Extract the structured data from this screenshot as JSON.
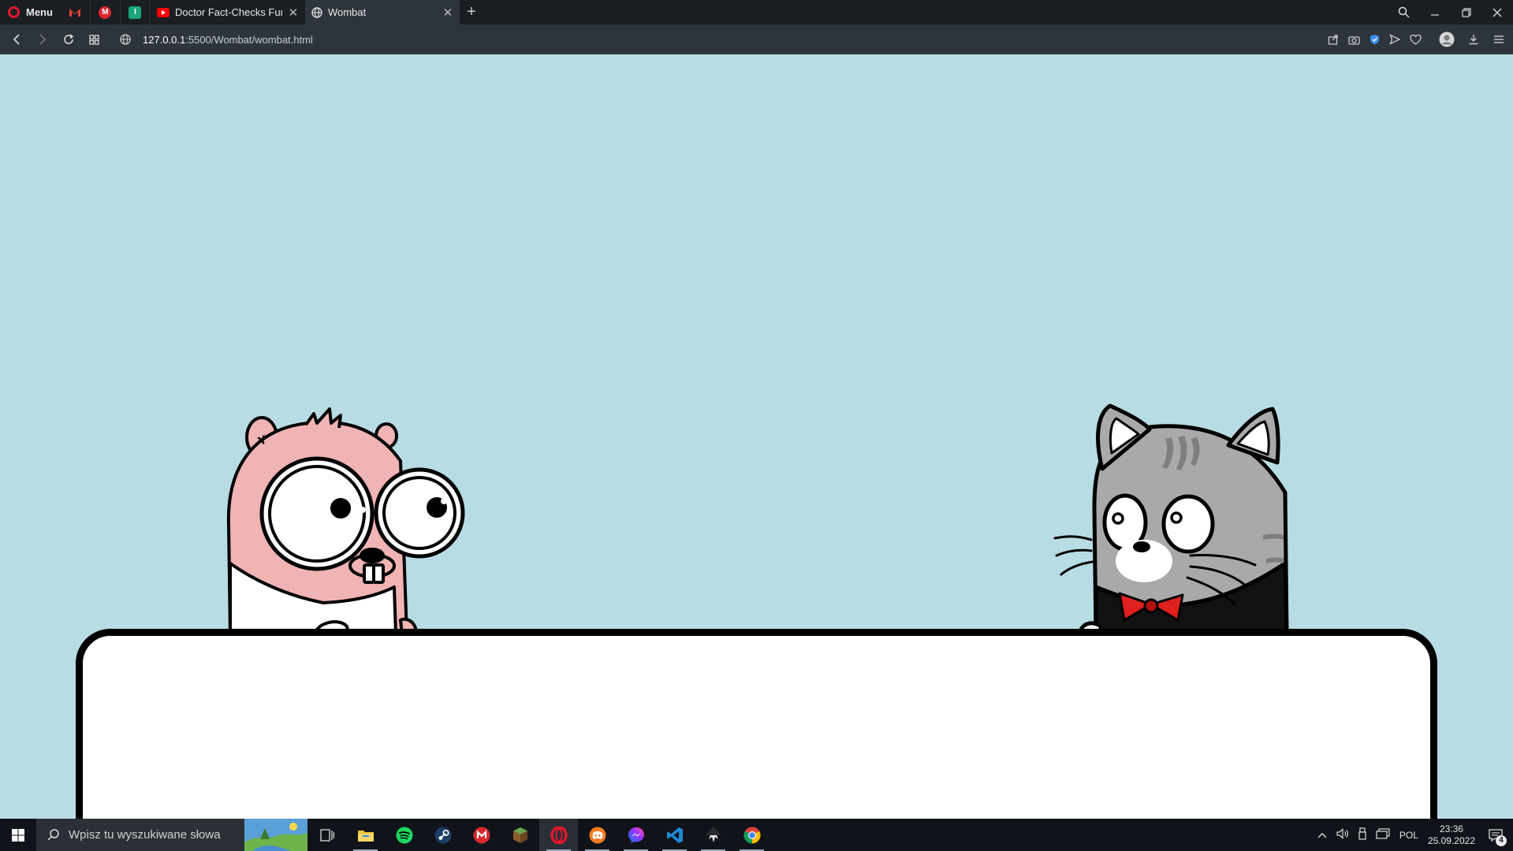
{
  "browser": {
    "menu_label": "Menu",
    "tabs": [
      {
        "title": "Doctor Fact-Checks Funnie",
        "favicon": "youtube-icon",
        "active": false
      },
      {
        "title": "Wombat",
        "favicon": "globe-icon",
        "active": true
      }
    ],
    "pinned_tabs": [
      "gmail-icon",
      "mega-icon",
      "keep-icon"
    ],
    "url_host": "127.0.0.1",
    "url_path": ":5500/Wombat/wombat.html"
  },
  "taskbar": {
    "search_placeholder": "Wpisz tu wyszukiwane słowa",
    "apps": [
      "task-view-icon",
      "file-explorer-icon",
      "spotify-icon",
      "steam-icon",
      "mega-icon",
      "minecraft-icon",
      "opera-icon",
      "discord-icon",
      "messenger-icon",
      "vscode-icon",
      "inkscape-icon",
      "chrome-icon"
    ],
    "language": "POL",
    "time": "23:36",
    "date": "25.09.2022",
    "notification_count": "4"
  },
  "colors": {
    "page_bg": "#b8dce4",
    "opera_red": "#e3172b",
    "hamster_pink": "#f0b4b4",
    "cat_grey": "#a9a9a9",
    "bowtie_red": "#e0201c"
  }
}
